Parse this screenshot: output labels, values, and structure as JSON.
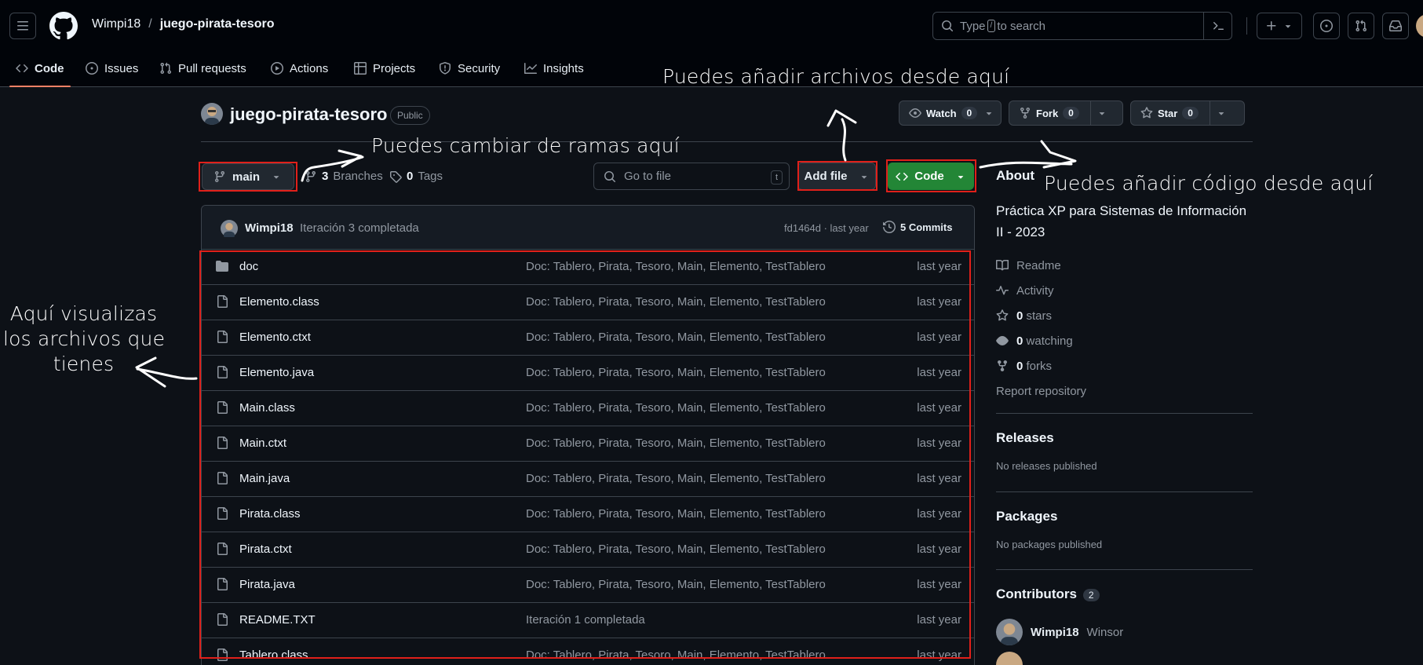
{
  "header": {
    "owner": "Wimpi18",
    "separator": "/",
    "repo": "juego-pirata-tesoro",
    "search_prefix": "Type",
    "search_key": "/",
    "search_suffix": "to search"
  },
  "nav": {
    "tabs": [
      {
        "label": "Code",
        "icon": "code-icon"
      },
      {
        "label": "Issues",
        "icon": "issue-opened-icon"
      },
      {
        "label": "Pull requests",
        "icon": "git-pull-request-icon"
      },
      {
        "label": "Actions",
        "icon": "play-icon"
      },
      {
        "label": "Projects",
        "icon": "table-icon"
      },
      {
        "label": "Security",
        "icon": "shield-icon"
      },
      {
        "label": "Insights",
        "icon": "graph-icon"
      }
    ]
  },
  "repo": {
    "title": "juego-pirata-tesoro",
    "visibility": "Public",
    "watch_label": "Watch",
    "watch_count": "0",
    "fork_label": "Fork",
    "fork_count": "0",
    "star_label": "Star",
    "star_count": "0"
  },
  "toolbar": {
    "branch": "main",
    "branches_count": "3",
    "branches_label": "Branches",
    "tags_count": "0",
    "tags_label": "Tags",
    "goto_placeholder": "Go to file",
    "goto_key": "t",
    "add_file_label": "Add file",
    "code_label": "Code"
  },
  "commit": {
    "author": "Wimpi18",
    "message": "Iteración 3 completada",
    "hash_time": "fd1464d · last year",
    "commits_label": "5 Commits"
  },
  "files": [
    {
      "name": "doc",
      "type": "folder",
      "message": "Doc: Tablero, Pirata, Tesoro, Main, Elemento, TestTablero",
      "date": "last year"
    },
    {
      "name": "Elemento.class",
      "type": "file",
      "message": "Doc: Tablero, Pirata, Tesoro, Main, Elemento, TestTablero",
      "date": "last year"
    },
    {
      "name": "Elemento.ctxt",
      "type": "file",
      "message": "Doc: Tablero, Pirata, Tesoro, Main, Elemento, TestTablero",
      "date": "last year"
    },
    {
      "name": "Elemento.java",
      "type": "file",
      "message": "Doc: Tablero, Pirata, Tesoro, Main, Elemento, TestTablero",
      "date": "last year"
    },
    {
      "name": "Main.class",
      "type": "file",
      "message": "Doc: Tablero, Pirata, Tesoro, Main, Elemento, TestTablero",
      "date": "last year"
    },
    {
      "name": "Main.ctxt",
      "type": "file",
      "message": "Doc: Tablero, Pirata, Tesoro, Main, Elemento, TestTablero",
      "date": "last year"
    },
    {
      "name": "Main.java",
      "type": "file",
      "message": "Doc: Tablero, Pirata, Tesoro, Main, Elemento, TestTablero",
      "date": "last year"
    },
    {
      "name": "Pirata.class",
      "type": "file",
      "message": "Doc: Tablero, Pirata, Tesoro, Main, Elemento, TestTablero",
      "date": "last year"
    },
    {
      "name": "Pirata.ctxt",
      "type": "file",
      "message": "Doc: Tablero, Pirata, Tesoro, Main, Elemento, TestTablero",
      "date": "last year"
    },
    {
      "name": "Pirata.java",
      "type": "file",
      "message": "Doc: Tablero, Pirata, Tesoro, Main, Elemento, TestTablero",
      "date": "last year"
    },
    {
      "name": "README.TXT",
      "type": "file",
      "message": "Iteración 1 completada",
      "date": "last year"
    },
    {
      "name": "Tablero.class",
      "type": "file",
      "message": "Doc: Tablero, Pirata, Tesoro, Main, Elemento, TestTablero",
      "date": "last year"
    }
  ],
  "sidebar": {
    "about_title": "About",
    "description": "Práctica XP para Sistemas de Información II - 2023",
    "readme": "Readme",
    "activity": "Activity",
    "stars_count": "0",
    "stars_label": "stars",
    "watching_count": "0",
    "watching_label": "watching",
    "forks_count": "0",
    "forks_label": "forks",
    "report": "Report repository",
    "releases_title": "Releases",
    "releases_empty": "No releases published",
    "packages_title": "Packages",
    "packages_empty": "No packages published",
    "contributors_title": "Contributors",
    "contributors_count": "2",
    "contributors": [
      {
        "login": "Wimpi18",
        "name": "Winsor"
      }
    ]
  },
  "annotations": {
    "add_files": "Puedes añadir archivos desde aquí",
    "branches": "Puedes cambiar de ramas aquí",
    "add_code": "Puedes añadir código desde aquí",
    "files_line1": "Aquí visualizas",
    "files_line2": "los archivos que",
    "files_line3": "tienes"
  },
  "colors": {
    "background": "#0d1117",
    "header_bg": "#010409",
    "border": "#3d444d",
    "code_button": "#238636",
    "active_tab": "#f78166",
    "annotation_box": "#e0201a"
  }
}
